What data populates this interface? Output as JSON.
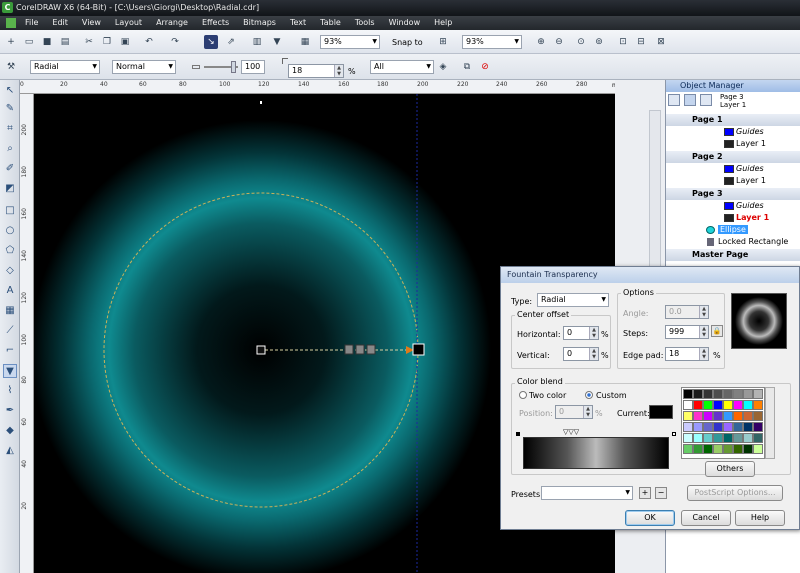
{
  "window": {
    "title": "CorelDRAW X6 (64-Bit) - [C:\\Users\\Giorgi\\Desktop\\Radial.cdr]"
  },
  "menu": [
    "File",
    "Edit",
    "View",
    "Layout",
    "Arrange",
    "Effects",
    "Bitmaps",
    "Text",
    "Table",
    "Tools",
    "Window",
    "Help"
  ],
  "std_toolbar": {
    "zoom1": "93%",
    "snap_label": "Snap to",
    "zoom2": "93%"
  },
  "prop_bar": {
    "type": "Radial",
    "mode": "Normal",
    "midpoint": "100",
    "edge_pad": "18",
    "edge_unit": "%",
    "apply_to": "All"
  },
  "ruler": {
    "top_ticks": [
      "0",
      "20",
      "40",
      "60",
      "80",
      "100",
      "120",
      "140",
      "160",
      "180",
      "200",
      "220",
      "240",
      "260",
      "280"
    ],
    "unit": "millimeters",
    "left_ticks": [
      "200",
      "180",
      "160",
      "140",
      "120",
      "100",
      "80",
      "60",
      "40",
      "20"
    ]
  },
  "object_manager": {
    "title": "Object Manager",
    "header_page": "Page 3",
    "header_layer": "Layer 1",
    "rows": [
      {
        "kind": "page",
        "label": "Page 1"
      },
      {
        "kind": "item",
        "label": "Guides",
        "color": "#0000ff"
      },
      {
        "kind": "item",
        "label": "Layer 1",
        "color": "#222222"
      },
      {
        "kind": "page",
        "label": "Page 2"
      },
      {
        "kind": "item",
        "label": "Guides",
        "color": "#0000ff"
      },
      {
        "kind": "item",
        "label": "Layer 1",
        "color": "#222222"
      },
      {
        "kind": "page",
        "label": "Page 3"
      },
      {
        "kind": "item",
        "label": "Guides",
        "color": "#0000ff"
      },
      {
        "kind": "item-active",
        "label": "Layer 1",
        "color": "#222222"
      },
      {
        "kind": "object",
        "label": "Ellipse"
      },
      {
        "kind": "object2",
        "label": "Locked Rectangle"
      },
      {
        "kind": "page",
        "label": "Master Page"
      }
    ]
  },
  "dialog": {
    "title": "Fountain Transparency",
    "type_label": "Type:",
    "type_value": "Radial",
    "center_offset": "Center offset",
    "horizontal_label": "Horizontal:",
    "horizontal_value": "0",
    "vertical_label": "Vertical:",
    "vertical_value": "0",
    "pct": "%",
    "options": "Options",
    "angle_label": "Angle:",
    "angle_value": "0.0",
    "steps_label": "Steps:",
    "steps_value": "999",
    "edgepad_label": "Edge pad:",
    "edgepad_value": "18",
    "color_blend": "Color blend",
    "two_color": "Two color",
    "custom": "Custom",
    "position_label": "Position:",
    "position_value": "0",
    "current_label": "Current:",
    "others": "Others",
    "presets_label": "Presets:",
    "postscript": "PostScript Options...",
    "ok": "OK",
    "cancel": "Cancel",
    "help": "Help"
  },
  "palette": [
    "#000000",
    "#1a1a1a",
    "#333333",
    "#4d4d4d",
    "#666666",
    "#808080",
    "#999999",
    "#b3b3b3",
    "#ffffff",
    "#ff0000",
    "#00ff00",
    "#0000ff",
    "#ffff00",
    "#ff00ff",
    "#00ffff",
    "#ff8000",
    "#ffff66",
    "#ff33cc",
    "#cc00ff",
    "#6633cc",
    "#3399ff",
    "#ff6600",
    "#cc6633",
    "#996633",
    "#ccccff",
    "#9999ff",
    "#6666cc",
    "#3333cc",
    "#9966ff",
    "#336699",
    "#003366",
    "#330066",
    "#ccffff",
    "#99ffff",
    "#66cccc",
    "#339999",
    "#006666",
    "#669999",
    "#99cccc",
    "#336666",
    "#66cc66",
    "#339933",
    "#006600",
    "#99cc66",
    "#669933",
    "#336600",
    "#003300",
    "#ccff99"
  ]
}
